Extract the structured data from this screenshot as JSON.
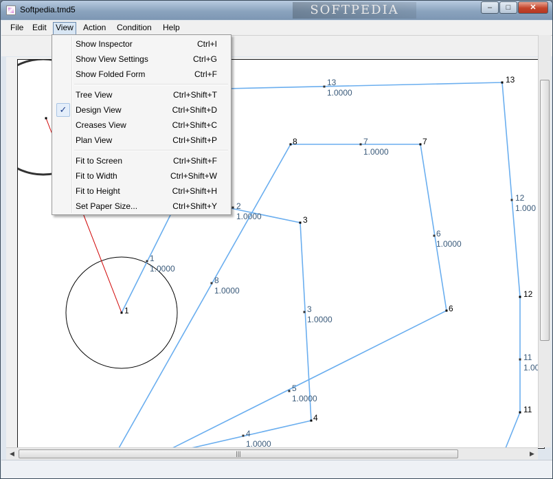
{
  "window": {
    "title": "Softpedia.tmd5",
    "watermark": "SOFTPEDIA"
  },
  "caption_buttons": {
    "minimize": "–",
    "maximize": "□",
    "close": "✕"
  },
  "menubar": [
    {
      "label": "File"
    },
    {
      "label": "Edit"
    },
    {
      "label": "View"
    },
    {
      "label": "Action"
    },
    {
      "label": "Condition"
    },
    {
      "label": "Help"
    }
  ],
  "view_menu": {
    "groups": [
      [
        {
          "label": "Show Inspector",
          "shortcut": "Ctrl+I"
        },
        {
          "label": "Show View Settings",
          "shortcut": "Ctrl+G"
        },
        {
          "label": "Show Folded Form",
          "shortcut": "Ctrl+F"
        }
      ],
      [
        {
          "label": "Tree View",
          "shortcut": "Ctrl+Shift+T",
          "checked": false
        },
        {
          "label": "Design View",
          "shortcut": "Ctrl+Shift+D",
          "checked": true
        },
        {
          "label": "Creases View",
          "shortcut": "Ctrl+Shift+C",
          "checked": false
        },
        {
          "label": "Plan View",
          "shortcut": "Ctrl+Shift+P",
          "checked": false
        }
      ],
      [
        {
          "label": "Fit to Screen",
          "shortcut": "Ctrl+Shift+F"
        },
        {
          "label": "Fit to Width",
          "shortcut": "Ctrl+Shift+W"
        },
        {
          "label": "Fit to Height",
          "shortcut": "Ctrl+Shift+H"
        },
        {
          "label": "Set Paper Size...",
          "shortcut": "Ctrl+Shift+Y"
        }
      ]
    ],
    "check_glyph": "✓"
  },
  "design": {
    "node_labels": {
      "n13": "13",
      "n7": "7",
      "n8": "8",
      "n3": "3",
      "n6": "6",
      "n12": "12",
      "n11": "11",
      "n4": "4",
      "n1": "1"
    },
    "edge_labels": {
      "e13": "13",
      "e13_len": "1.0000",
      "e7": "7",
      "e7_len": "1.0000",
      "e2": "2",
      "e2_len": "1.0000",
      "e12": "12",
      "e12_len": "1.000",
      "e6": "6",
      "e6_len": "1.0000",
      "e1": "1",
      "e1_len": "1.0000",
      "e8": "8",
      "e8_len": "1.0000",
      "e3": "3",
      "e3_len": "1.0000",
      "e11": "11",
      "e11_len": "1.00",
      "e5": "5",
      "e5_len": "1.0000",
      "e4": "4",
      "e4_len": "1.0000"
    },
    "colors": {
      "edge": "#6aaeef",
      "circle": "#000000",
      "path": "#d00000",
      "edge_label": "#3a5a7a"
    }
  },
  "scrollbar": {
    "h_grip": "|||"
  }
}
